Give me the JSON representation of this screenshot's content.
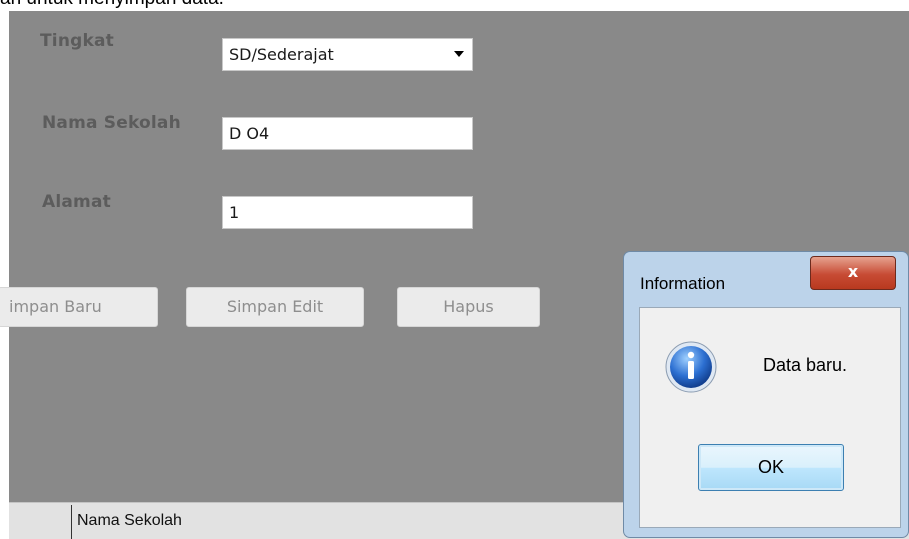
{
  "top_caption": "an untuk menyimpan data.",
  "form": {
    "tingkat_label": "Tingkat",
    "tingkat_value": "SD/Sederajat",
    "nama_sekolah_label": "Nama Sekolah",
    "nama_sekolah_value": "D O4",
    "alamat_label": "Alamat",
    "alamat_value": "1"
  },
  "buttons": {
    "simpan_baru": "impan Baru",
    "simpan_edit": "Simpan Edit",
    "hapus": "Hapus"
  },
  "statusbar": {
    "text": "Nama Sekolah"
  },
  "dialog": {
    "title": "Information",
    "close": "x",
    "message": "Data baru.",
    "ok": "OK",
    "icon": "info-icon"
  }
}
